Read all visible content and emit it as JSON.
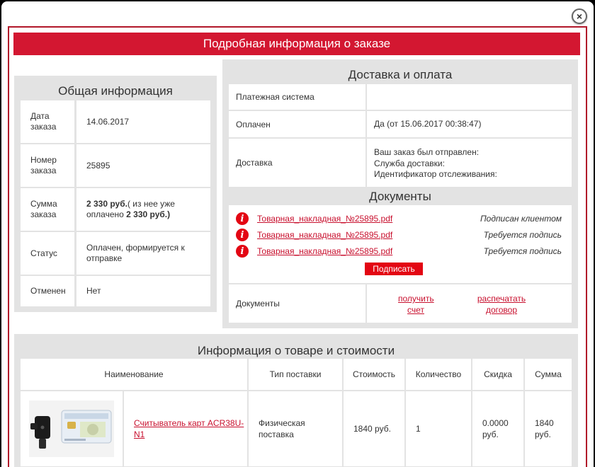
{
  "dialog": {
    "close_label": "×",
    "title": "Подробная информация о заказе"
  },
  "general": {
    "title": "Общая информация",
    "rows": [
      {
        "label": "Дата заказа",
        "value": "14.06.2017"
      },
      {
        "label": "Номер заказа",
        "value": "25895"
      },
      {
        "label": "Сумма заказа",
        "value_bold1": "2 330 руб.",
        "value_mid": "( из нее уже оплачено ",
        "value_bold2": "2 330 руб.)"
      },
      {
        "label": "Статус",
        "value": "Оплачен, формируется к отправке"
      },
      {
        "label": "Отменен",
        "value": "Нет"
      }
    ]
  },
  "delivery": {
    "title": "Доставка и оплата",
    "rows": [
      {
        "label": "Платежная система",
        "value": ""
      },
      {
        "label": "Оплачен",
        "value": "Да (от 15.06.2017 00:38:47)"
      },
      {
        "label": "Доставка",
        "lines": [
          "Ваш заказ был отправлен:",
          "Служба доставки:",
          "Идентификатор отслеживания:"
        ]
      }
    ]
  },
  "documents": {
    "title": "Документы",
    "warn_glyph": "i",
    "items": [
      {
        "file": "Товарная_накладная_№25895.pdf",
        "status": "Подписан клиентом"
      },
      {
        "file": "Товарная_накладная_№25895.pdf",
        "status": "Требуется подпись"
      },
      {
        "file": "Товарная_накладная_№25895.pdf",
        "status": "Требуется подпись"
      }
    ],
    "sign_button": "Подписать",
    "row_label": "Документы",
    "link_invoice": [
      "получить",
      "счет"
    ],
    "link_contract": [
      "распечатать",
      "договор"
    ]
  },
  "products": {
    "title": "Информация о товаре и стоимости",
    "headers": [
      "Наименование",
      "Тип поставки",
      "Стоимость",
      "Количество",
      "Скидка",
      "Сумма"
    ],
    "rows": [
      {
        "name": "Считыватель карт ACR38U-N1",
        "delivery_type": "Физическая поставка",
        "price": "1840 руб.",
        "qty": "1",
        "discount": "0.0000 руб.",
        "sum": "1840 руб."
      }
    ]
  },
  "colors": {
    "accent": "#d31731",
    "panel_bg": "#e3e3e3",
    "link": "#c8102e"
  }
}
